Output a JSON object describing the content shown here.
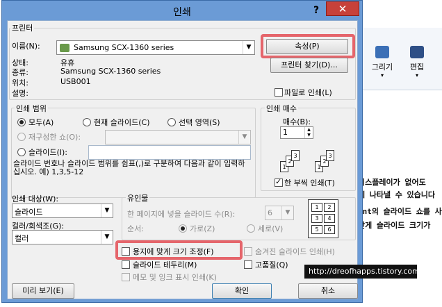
{
  "background": {
    "ribbon": {
      "draw_label": "그리기",
      "edit_label": "편집"
    },
    "text_lines": [
      "디스플레이가 없어도",
      "에 나타낼 수 있습니다",
      "ent의 슬라이드 쇼를 사용",
      "맞게 슬라이드 크기가"
    ]
  },
  "dialog": {
    "title": "인쇄",
    "help": "?",
    "close": "✕",
    "printer": {
      "group_label": "프린터",
      "name_label": "이름(N):",
      "name_value": "Samsung SCX-1360 series",
      "properties_button": "속성(P)",
      "find_printer_button": "프린터 찾기(D)...",
      "status_label": "상태:",
      "status_value": "유휴",
      "type_label": "종류:",
      "type_value": "Samsung SCX-1360 series",
      "where_label": "위치:",
      "where_value": "USB001",
      "comment_label": "설명:",
      "print_to_file_label": "파일로 인쇄(L)"
    },
    "print_range": {
      "group_label": "인쇄 범위",
      "all_label": "모두(A)",
      "current_slide_label": "현재 슬라이드(C)",
      "selection_label": "선택 영역(S)",
      "custom_show_label": "재구성한 쇼(O):",
      "slides_label": "슬라이드(I):",
      "hint": "슬라이드 번호나 슬라이드 범위를 쉼표(,)로 구분하여 다음과 같이 입력하십시오. 예) 1,3,5-12"
    },
    "copies": {
      "group_label": "인쇄 매수",
      "count_label": "매수(B):",
      "count_value": "1",
      "collate_label": "한 부씩 인쇄(T)"
    },
    "print_what": {
      "label": "인쇄 대상(W):",
      "value": "슬라이드"
    },
    "color": {
      "label": "컬러/회색조(G):",
      "value": "컬러"
    },
    "handouts": {
      "group_label": "유인물",
      "slides_per_page_label": "한 페이지에 넣을 슬라이드 수(R):",
      "slides_per_page_value": "6",
      "order_label": "순서:",
      "horizontal_label": "가로(Z)",
      "vertical_label": "세로(V)"
    },
    "options": {
      "scale_to_fit": "용지에 맞게 크기 조정(F)",
      "frame_slides": "슬라이드 테두리(M)",
      "print_comments": "메모 및 잉크 표시 인쇄(K)",
      "print_hidden": "숨겨진 슬라이드 인쇄(H)",
      "high_quality": "고품질(Q)"
    },
    "preview_button": "미리 보기(E)",
    "ok_button": "확인",
    "cancel_button": "취소"
  },
  "watermark": "http://dreofhapps.tistory.com",
  "colors": {
    "highlight": "#e5656b",
    "titlebar": "#6b9bd6",
    "close": "#c7413a"
  }
}
